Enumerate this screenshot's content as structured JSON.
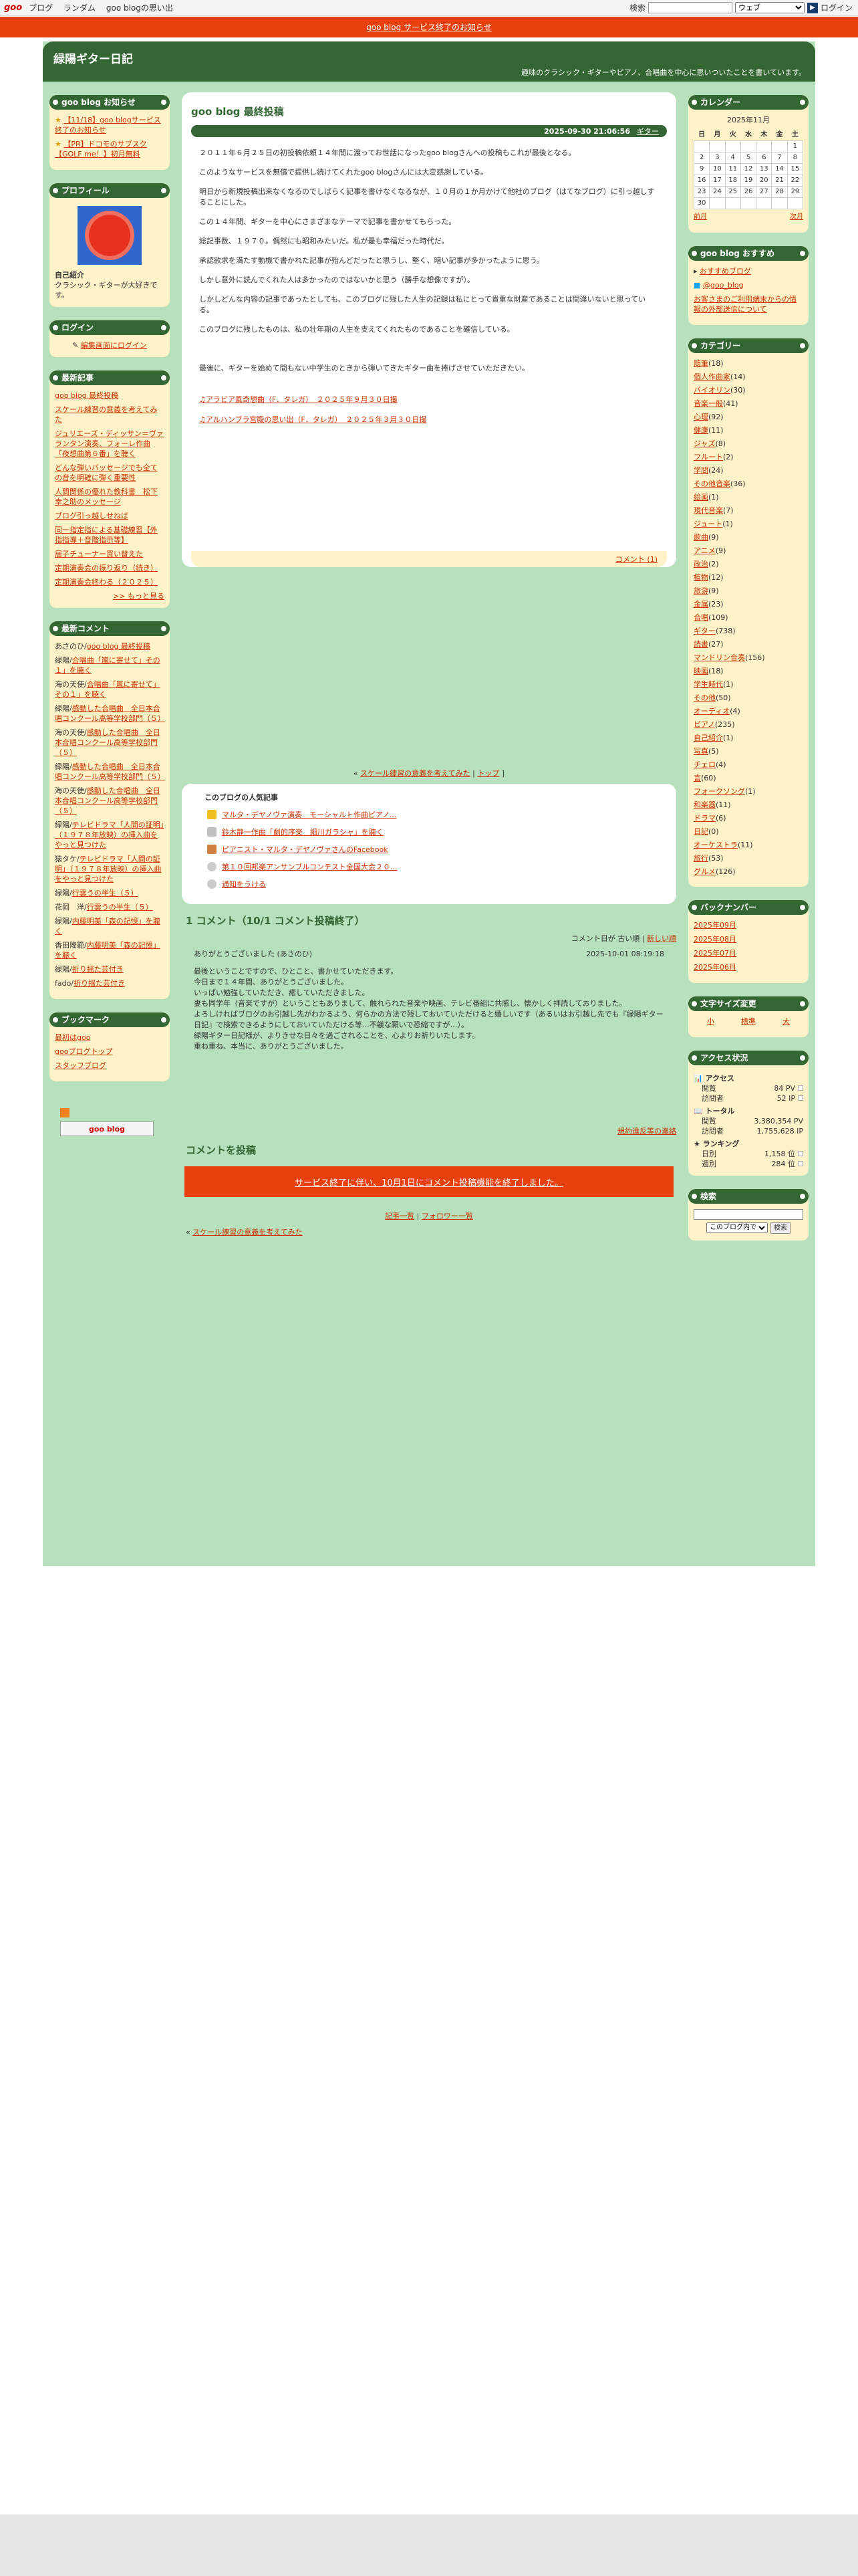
{
  "topbar": {
    "logo": "goo",
    "nav": [
      "ブログ",
      "ランダム",
      "goo blogの思い出"
    ],
    "search_label": "検索",
    "search_select": "ウェブ",
    "login": "ログイン"
  },
  "notice": "goo blog サービス終了のお知らせ",
  "header": {
    "title": "緑陽ギター日記",
    "desc": "趣味のクラシック・ギターやピアノ、合唱曲を中心に思いついたことを書いています。"
  },
  "left": {
    "oshirase": {
      "title": "goo blog お知らせ",
      "items": [
        "【11/18】goo blogサービス終了のお知らせ",
        "【PR】ドコモのサブスク【GOLF me！】初月無料"
      ]
    },
    "profile": {
      "title": "プロフィール",
      "label": "自己紹介",
      "text": "クラシック・ギターが大好きです。"
    },
    "login": {
      "title": "ログイン",
      "link": "編集画面にログイン"
    },
    "recent": {
      "title": "最新記事",
      "items": [
        "goo blog 最終投稿",
        "スケール練習の意義を考えてみた",
        "ジュリエーズ・ディッサン＝ヴァランタン演奏、フォーレ作曲「夜想曲第６番」を聴く",
        "どんな弾いバッセージでも全ての音を明確に弾く重要性",
        "人間関係の優れた教科書　松下幸之助のメッセージ",
        "ブログ引っ越しせねば",
        "同一指定指による基礎練習【外指指導＋音階指示等】",
        "居子チューナー買い替えた",
        "定期演奏会の振り返り（続き）",
        "定期演奏会終わる（２０２５）"
      ],
      "more": ">> もっと見る"
    },
    "comments": {
      "title": "最新コメント",
      "items": [
        {
          "who": "あさのひ",
          "link": "goo blog 最終投稿"
        },
        {
          "who": "緑陽",
          "link": "合唱曲「嵐に寄せて」その１」を聴く"
        },
        {
          "who": "海の天使",
          "link": "合唱曲「嵐に寄せて」その１」を聴く"
        },
        {
          "who": "緑陽",
          "link": "感動した合唱曲　全日本合唱コンクール高等学校部門（５）"
        },
        {
          "who": "海の天使",
          "link": "感動した合唱曲　全日本合唱コンクール高等学校部門（５）"
        },
        {
          "who": "緑陽",
          "link": "感動した合唱曲　全日本合唱コンクール高等学校部門（５）"
        },
        {
          "who": "海の天使",
          "link": "感動した合唱曲　全日本合唱コンクール高等学校部門（５）"
        },
        {
          "who": "緑陽",
          "link": "テレビドラマ「人間の証明」（１９７８年放映）の挿入曲をやっと見つけた"
        },
        {
          "who": "猿タケ",
          "link": "テレビドラマ「人間の証明」（１９７８年放映）の挿入曲をやっと見つけた"
        },
        {
          "who": "緑陽",
          "link": "行雲うの半生（５）"
        },
        {
          "who": "花岡　洋",
          "link": "行雲うの半生（５）"
        },
        {
          "who": "緑陽",
          "link": "内藤明美「森の記憶」を聴く"
        },
        {
          "who": "香田隆範",
          "link": "内藤明美「森の記憶」を聴く"
        },
        {
          "who": "緑陽",
          "link": "祈り揺た芸付き"
        },
        {
          "who": "fado",
          "link": "祈り揺た芸付き"
        }
      ]
    },
    "bookmark": {
      "title": "ブックマーク",
      "items": [
        "最初はgoo",
        "gooブログトップ",
        "スタッフブログ"
      ]
    },
    "goo_logo": "goo blog"
  },
  "main": {
    "post": {
      "title": "goo blog 最終投稿",
      "datetime": "2025-09-30 21:06:56",
      "category": "ギター",
      "paragraphs": [
        "２０１１年６月２５日の初投稿依頼１４年間に渡ってお世話になったgoo blogさんへの投稿もこれが最後となる。",
        "このようなサービスを無償で提供し続けてくれたgoo blogさんには大変感謝している。",
        "明日から新規投稿出来なくなるのでしばらく記事を書けなくなるなが、１０月の１か月かけて他社のブログ（はてなブログ）に引っ越しすることにした。",
        "この１４年間、ギターを中心にさまざまなテーマで記事を書かせてもらった。",
        "総記事数、１９７０。偶然にも昭和みたいだ。私が最も幸福だった時代だ。",
        "承認欲求を満たす動機で書かれた記事が殆んどだったと思うし、堅く、暗い記事が多かったように思う。",
        "しかし意外に読んでくれた人は多かったのではないかと思う（勝手な想像ですが）。",
        "しかしどんな内容の記事であったとしても、このブログに残した人生の記録は私にとって貴重な財産であることは間違いないと思っている。",
        "このブログに残したものは、私の壮年期の人生を支えてくれたものであることを確信している。",
        "",
        "最後に、ギターを始めて間もない中学生のときから弾いてきたギター曲を捧げさせていただきたい。"
      ],
      "links": [
        "♫アラビア風奇想曲（F．タレガ）　２０２５年９月３０日撮",
        "♫アルハンブラ宮殿の思い出（F．タレガ）　２０２５年３月３０日撮"
      ],
      "comment_link": "コメント (1)"
    },
    "mid_links": {
      "a": "スケール練習の意義を考えてみた",
      "b": "トップ"
    },
    "popular": {
      "title": "このブログの人気記事",
      "items": [
        "マルタ・デヤノヴァ演奏　モーシャルト作曲ピアノ...",
        "鈴木静一作曲「劇的序楽　細川ガラシャ」を聴く",
        "ピアニスト・マルタ・デヤノヴァさんのFacebook",
        "第１０回邦楽アンサンブルコンテスト全国大会２０...",
        "通知をうける"
      ]
    },
    "comments_head": "1 コメント（10/1 コメント投稿終了）",
    "sort": {
      "label": "コメント日が",
      "old": "古い順",
      "new": "新しい順"
    },
    "comment": {
      "author": "ありがとうございました (あさのひ)",
      "date": "2025-10-01 08:19:18",
      "lines": [
        "最後ということですので、ひとこと、書かせていただきます。",
        "今日まで１４年間、ありがとうございました。",
        "いっぱい勉強していただき、癒していただきました。",
        "妻も同学年（音楽ですが）ということもありまして、触れられた音楽や映画、テレビ番組に共感し、懐かしく拝読しておりました。",
        "よろしければブログのお引越し先がわかるよう、何らかの方法で残しておいていただけると嬉しいです（あるいはお引越し先でも『緑陽ギター日記』で検索できるようにしておいていただける等…不躾な願いで恐縮ですが…）。",
        "緑陽ギター日記様が、よりきせな日々を過ごされることを、心よりお祈りいたします。",
        "重ね重ね、本当に、ありがとうございました。"
      ],
      "report": "規約違反等の連絡"
    },
    "post_comment": "コメントを投稿",
    "closed": "サービス終了に伴い、10月1日にコメント投稿機能を終了しました。",
    "bottom_links": {
      "a": "記事一覧",
      "b": "フォロワー一覧"
    },
    "bottom_prev": "スケール練習の意義を考えてみた"
  },
  "right": {
    "calendar": {
      "title": "カレンダー",
      "month": "2025年11月",
      "week": [
        "日",
        "月",
        "火",
        "水",
        "木",
        "金",
        "土"
      ],
      "days": [
        [
          "",
          "",
          "",
          "",
          "",
          "",
          "1"
        ],
        [
          "2",
          "3",
          "4",
          "5",
          "6",
          "7",
          "8"
        ],
        [
          "9",
          "10",
          "11",
          "12",
          "13",
          "14",
          "15"
        ],
        [
          "16",
          "17",
          "18",
          "19",
          "20",
          "21",
          "22"
        ],
        [
          "23",
          "24",
          "25",
          "26",
          "27",
          "28",
          "29"
        ],
        [
          "30",
          "",
          "",
          "",
          "",
          "",
          ""
        ]
      ],
      "prev": "前月",
      "next": "次月"
    },
    "recommend": {
      "title": "goo blog おすすめ",
      "link1": "おすすめブログ",
      "link2": "@goo_blog",
      "link3": "お客さまのご利用端末からの情報の外部送信について"
    },
    "categories": {
      "title": "カテゴリー",
      "items": [
        {
          "name": "随筆",
          "count": "(18)"
        },
        {
          "name": "個人作曲家",
          "count": "(14)"
        },
        {
          "name": "バイオリン",
          "count": "(30)"
        },
        {
          "name": "音楽一般",
          "count": "(41)"
        },
        {
          "name": "心理",
          "count": "(92)"
        },
        {
          "name": "健康",
          "count": "(11)"
        },
        {
          "name": "ジャズ",
          "count": "(8)"
        },
        {
          "name": "フルート",
          "count": "(2)"
        },
        {
          "name": "学問",
          "count": "(24)"
        },
        {
          "name": "その他音楽",
          "count": "(36)"
        },
        {
          "name": "絵画",
          "count": "(1)"
        },
        {
          "name": "現代音楽",
          "count": "(7)"
        },
        {
          "name": "ジュート",
          "count": "(1)"
        },
        {
          "name": "歌曲",
          "count": "(9)"
        },
        {
          "name": "アニメ",
          "count": "(9)"
        },
        {
          "name": "政治",
          "count": "(2)"
        },
        {
          "name": "植物",
          "count": "(12)"
        },
        {
          "name": "旅游",
          "count": "(9)"
        },
        {
          "name": "金属",
          "count": "(23)"
        },
        {
          "name": "合唱",
          "count": "(109)"
        },
        {
          "name": "ギター",
          "count": "(738)"
        },
        {
          "name": "読書",
          "count": "(27)"
        },
        {
          "name": "マンドリン合奏",
          "count": "(156)"
        },
        {
          "name": "映画",
          "count": "(18)"
        },
        {
          "name": "学生時代",
          "count": "(1)"
        },
        {
          "name": "その他",
          "count": "(50)"
        },
        {
          "name": "オーディオ",
          "count": "(4)"
        },
        {
          "name": "ピアノ",
          "count": "(235)"
        },
        {
          "name": "自己紹介",
          "count": "(1)"
        },
        {
          "name": "写真",
          "count": "(5)"
        },
        {
          "name": "チェロ",
          "count": "(4)"
        },
        {
          "name": "言",
          "count": "(60)"
        },
        {
          "name": "フォークソング",
          "count": "(1)"
        },
        {
          "name": "和楽器",
          "count": "(11)"
        },
        {
          "name": "ドラマ",
          "count": "(6)"
        },
        {
          "name": "日記",
          "count": "(0)"
        },
        {
          "name": "オーケストラ",
          "count": "(11)"
        },
        {
          "name": "旅行",
          "count": "(53)"
        },
        {
          "name": "グルメ",
          "count": "(126)"
        }
      ]
    },
    "backnumber": {
      "title": "バックナンバー",
      "items": [
        "2025年09月",
        "2025年08月",
        "2025年07月",
        "2025年06月"
      ]
    },
    "fontsize": {
      "title": "文字サイズ変更",
      "small": "小",
      "mid": "標準",
      "large": "大"
    },
    "access": {
      "title": "アクセス状況",
      "sec1": "アクセス",
      "pv_label": "閲覧",
      "pv": "84 PV",
      "ip_label": "訪問者",
      "ip": "52 IP",
      "sec2": "トータル",
      "tpv_label": "閲覧",
      "tpv": "3,380,354 PV",
      "tip_label": "訪問者",
      "tip": "1,755,628 IP",
      "sec3": "ランキング",
      "d_label": "日別",
      "d": "1,158 位",
      "w_label": "週別",
      "w": "284 位"
    },
    "search": {
      "title": "検索",
      "scope": "このブログ内で",
      "btn": "検索"
    }
  }
}
